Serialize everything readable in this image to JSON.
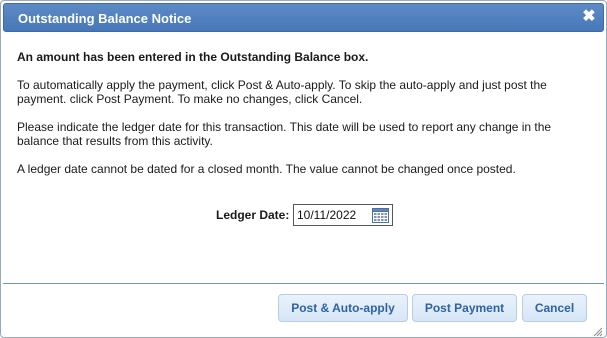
{
  "dialog": {
    "title": "Outstanding Balance Notice",
    "close_glyph": "✖"
  },
  "message": {
    "heading": "An amount has been entered in the Outstanding Balance box.",
    "paragraph_1": "To automatically apply the payment, click Post & Auto-apply. To skip the auto-apply and just post the payment. click Post Payment. To make no changes, click Cancel.",
    "paragraph_2": "Please indicate the ledger date for this transaction. This date will be used to report any change in the balance that results from this activity.",
    "paragraph_3": "A ledger date cannot be dated for a closed month. The value cannot be changed once posted."
  },
  "ledger": {
    "label": "Ledger Date:",
    "value": "10/11/2022",
    "calendar_icon": "calendar-icon"
  },
  "buttons": {
    "post_auto_apply": "Post & Auto-apply",
    "post_payment": "Post Payment",
    "cancel": "Cancel"
  },
  "colors": {
    "titlebar": "#4f7fbe",
    "button_text": "#2d62a3",
    "divider": "#6f95c8"
  }
}
